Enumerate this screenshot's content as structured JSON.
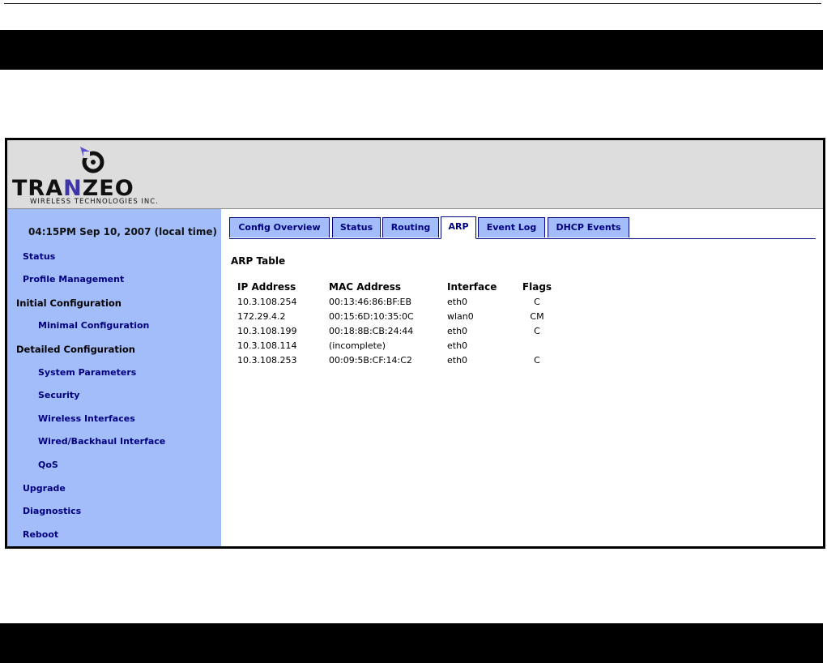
{
  "logo": {
    "wordmark_left": "TRA",
    "wordmark_accent": "N",
    "wordmark_right": "ZEO",
    "tagline": "WIRELESS TECHNOLOGIES INC.",
    "icon": "tranzeo-antenna-icon"
  },
  "sidebar": {
    "clock": "04:15PM Sep 10, 2007 (local time)",
    "items": [
      {
        "label": "Status"
      },
      {
        "label": "Profile Management"
      },
      {
        "label": "Initial Configuration"
      },
      {
        "label": "Minimal Configuration"
      },
      {
        "label": "Detailed Configuration"
      },
      {
        "label": "System Parameters"
      },
      {
        "label": "Security"
      },
      {
        "label": "Wireless Interfaces"
      },
      {
        "label": "Wired/Backhaul Interface"
      },
      {
        "label": "QoS"
      },
      {
        "label": "Upgrade"
      },
      {
        "label": "Diagnostics"
      },
      {
        "label": "Reboot"
      }
    ]
  },
  "tabs": [
    {
      "label": "Config Overview"
    },
    {
      "label": "Status"
    },
    {
      "label": "Routing"
    },
    {
      "label": "ARP",
      "active": true
    },
    {
      "label": "Event Log"
    },
    {
      "label": "DHCP Events"
    }
  ],
  "arp": {
    "title": "ARP Table",
    "headers": [
      "IP Address",
      "MAC Address",
      "Interface",
      "Flags"
    ],
    "rows": [
      [
        "10.3.108.254",
        "00:13:46:86:BF:EB",
        "eth0",
        "C"
      ],
      [
        "172.29.4.2",
        "00:15:6D:10:35:0C",
        "wlan0",
        "CM"
      ],
      [
        "10.3.108.199",
        "00:18:8B:CB:24:44",
        "eth0",
        "C"
      ],
      [
        "10.3.108.114",
        "(incomplete)",
        "eth0",
        ""
      ],
      [
        "10.3.108.253",
        "00:09:5B:CF:14:C2",
        "eth0",
        "C"
      ]
    ]
  },
  "colors": {
    "sidebar_bg": "#a3bdfb",
    "link": "#000080",
    "header_bg": "#dddddd",
    "band": "#000000"
  }
}
